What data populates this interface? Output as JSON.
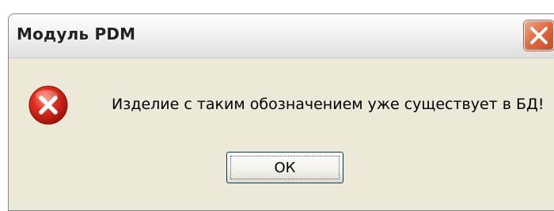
{
  "window": {
    "title": "Модуль PDM",
    "close_icon": "close-icon"
  },
  "dialog": {
    "icon": "error-icon",
    "message": "Изделие с таким обозначением уже существует в БД!",
    "ok_label": "ОК"
  },
  "colors": {
    "background": "#ece9d8",
    "close_button": "#e0683f",
    "error_icon": "#d4221a"
  }
}
